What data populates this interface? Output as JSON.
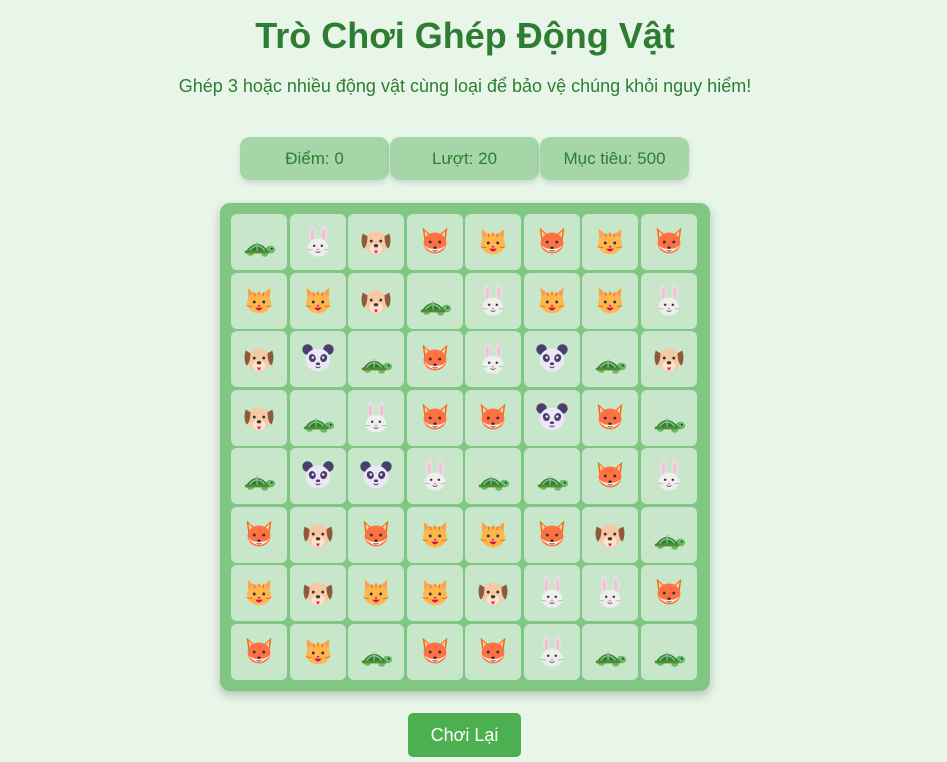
{
  "header": {
    "title": "Trò Chơi Ghép Động Vật",
    "subtitle": "Ghép 3 hoặc nhiều động vật cùng loại để bảo vệ chúng khỏi nguy hiểm!"
  },
  "stats": {
    "score_label": "Điểm: 0",
    "moves_label": "Lượt: 20",
    "target_label": "Mục tiêu: 500",
    "score": 0,
    "moves": 20,
    "target": 500
  },
  "board": {
    "rows": 8,
    "cols": 8,
    "grid": [
      [
        "turtle",
        "rabbit",
        "dog",
        "fox",
        "cat",
        "fox",
        "cat",
        "fox"
      ],
      [
        "cat",
        "cat",
        "dog",
        "turtle",
        "rabbit",
        "cat",
        "cat",
        "rabbit"
      ],
      [
        "dog",
        "panda",
        "turtle",
        "fox",
        "rabbit",
        "panda",
        "turtle",
        "dog"
      ],
      [
        "dog",
        "turtle",
        "rabbit",
        "fox",
        "fox",
        "panda",
        "fox",
        "turtle"
      ],
      [
        "turtle",
        "panda",
        "panda",
        "rabbit",
        "turtle",
        "turtle",
        "fox",
        "rabbit"
      ],
      [
        "fox",
        "dog",
        "fox",
        "cat",
        "cat",
        "fox",
        "dog",
        "turtle"
      ],
      [
        "cat",
        "dog",
        "cat",
        "cat",
        "dog",
        "rabbit",
        "rabbit",
        "fox"
      ],
      [
        "fox",
        "cat",
        "turtle",
        "fox",
        "fox",
        "rabbit",
        "turtle",
        "turtle"
      ]
    ]
  },
  "actions": {
    "restart_label": "Chơi Lại"
  },
  "colors": {
    "background": "#e8f5e9",
    "title": "#2e7d32",
    "stat_box": "#a5d6a7",
    "board": "#81c784",
    "cell": "#c8e6c9",
    "button": "#4caf50"
  }
}
